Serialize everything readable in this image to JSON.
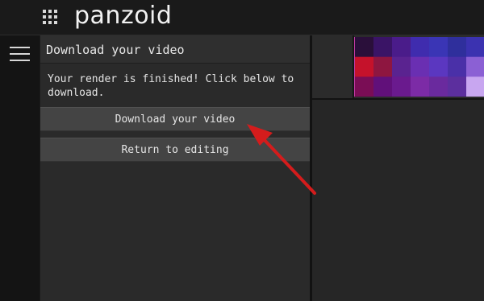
{
  "header": {
    "logo_text": "panzoid",
    "apps_icon": "grid-dots-icon",
    "background": "#1a1a1a"
  },
  "sidebar": {
    "menu_icon": "hamburger-menu-icon"
  },
  "render_panel": {
    "title": "Download your video",
    "message": "Your render is finished! Click below to download.",
    "download_button_label": "Download your video",
    "return_button_label": "Return to editing",
    "button_color": "#444444",
    "panel_color": "#2a2a2a"
  },
  "preview": {
    "thumbnail_description_icon": "video-thumbnail",
    "accent_border": "#c23aa4",
    "colors": [
      [
        "#2a0f3a",
        "#3a1466",
        "#4a1c8a",
        "#3f2cae",
        "#3a35b5",
        "#2f2f9c",
        "#3b32b0"
      ],
      [
        "#c5122b",
        "#8e1640",
        "#5a2390",
        "#6a2fb2",
        "#5b37c0",
        "#4a30a8",
        "#8b60d4"
      ],
      [
        "#7a0d55",
        "#61107a",
        "#6a1a8e",
        "#7c2ba6",
        "#6a2a9e",
        "#5c2f9e",
        "#c8a6f0"
      ]
    ]
  },
  "annotation": {
    "arrow_color": "#d41c1c",
    "arrow_icon": "red-arrow-icon"
  }
}
